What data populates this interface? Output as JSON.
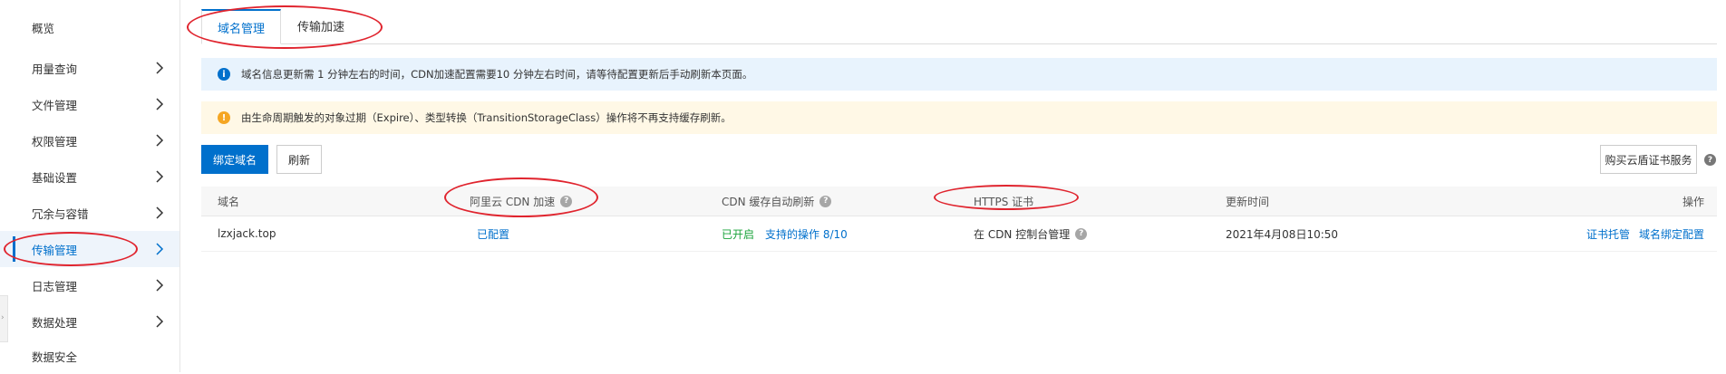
{
  "sidebar": {
    "items": [
      {
        "label": "概览",
        "chevron": false
      },
      {
        "label": "用量查询",
        "chevron": true
      },
      {
        "label": "文件管理",
        "chevron": true
      },
      {
        "label": "权限管理",
        "chevron": true
      },
      {
        "label": "基础设置",
        "chevron": true
      },
      {
        "label": "冗余与容错",
        "chevron": true
      },
      {
        "label": "传输管理",
        "chevron": true,
        "active": true
      },
      {
        "label": "日志管理",
        "chevron": true
      },
      {
        "label": "数据处理",
        "chevron": true
      },
      {
        "label": "数据安全",
        "chevron": false
      }
    ],
    "collapse_glyph": "›"
  },
  "tabs": [
    {
      "label": "域名管理",
      "active": true
    },
    {
      "label": "传输加速",
      "active": false
    }
  ],
  "notices": {
    "info": {
      "icon": "info-icon",
      "text": "域名信息更新需 1 分钟左右的时间，CDN加速配置需要10 分钟左右时间，请等待配置更新后手动刷新本页面。"
    },
    "warning": {
      "icon": "warning-icon",
      "text": "由生命周期触发的对象过期（Expire）、类型转换（TransitionStorageClass）操作将不再支持缓存刷新。"
    }
  },
  "toolbar": {
    "bind_domain": "绑定域名",
    "refresh": "刷新",
    "buy_cert": "购买云盾证书服务"
  },
  "table": {
    "headers": {
      "domain": "域名",
      "cdn": "阿里云 CDN 加速",
      "cache_refresh": "CDN 缓存自动刷新",
      "https": "HTTPS 证书",
      "updated": "更新时间",
      "actions": "操作"
    },
    "rows": [
      {
        "domain": "lzxjack.top",
        "cdn": "已配置",
        "cache_status": "已开启",
        "cache_ops": "支持的操作 8/10",
        "https": "在 CDN 控制台管理",
        "updated": "2021年4月08日10:50",
        "action_cert": "证书托管",
        "action_bind": "域名绑定配置"
      }
    ]
  },
  "colors": {
    "accent": "#0070cc",
    "annotation": "#e0242e",
    "info_bg": "#e8f3fd",
    "warning_bg": "#fff8e6",
    "enabled": "#1aa33b"
  }
}
